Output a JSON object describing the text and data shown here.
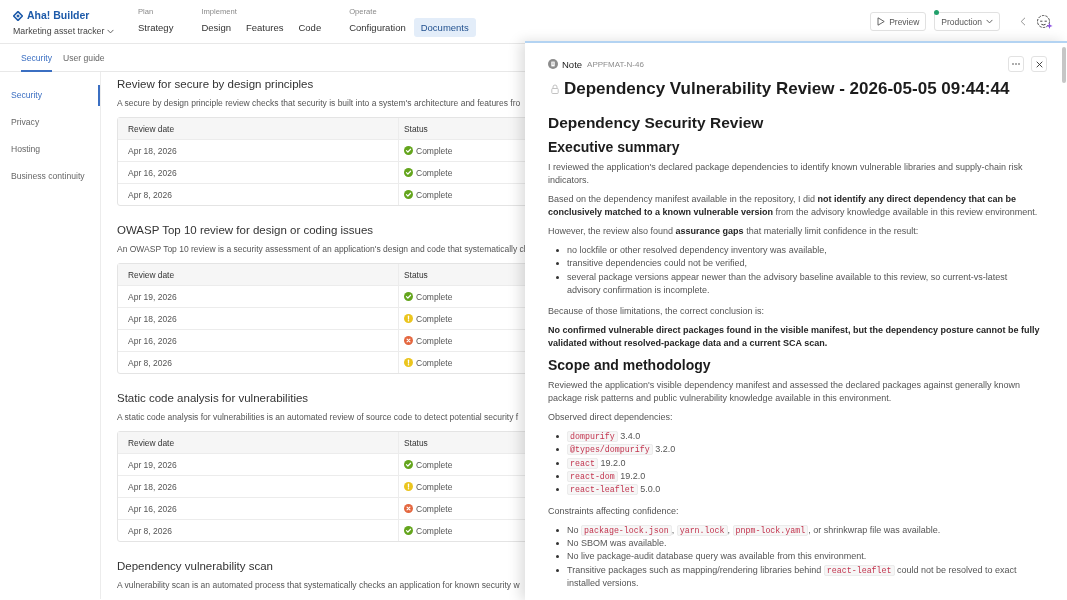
{
  "brand": {
    "name": "Aha! Builder",
    "workspace": "Marketing asset tracker"
  },
  "nav": [
    {
      "group": "Plan",
      "items": [
        {
          "label": "Strategy",
          "selected": false
        }
      ]
    },
    {
      "group": "Implement",
      "items": [
        {
          "label": "Design",
          "selected": false
        },
        {
          "label": "Features",
          "selected": false
        },
        {
          "label": "Code",
          "selected": false
        }
      ]
    },
    {
      "group": "Operate",
      "items": [
        {
          "label": "Configuration",
          "selected": false
        },
        {
          "label": "Documents",
          "selected": true
        }
      ]
    }
  ],
  "toolbar": {
    "preview": "Preview",
    "environment": "Production"
  },
  "tabs": [
    {
      "label": "Security",
      "selected": true
    },
    {
      "label": "User guide",
      "selected": false
    }
  ],
  "sidebar": {
    "items": [
      {
        "label": "Security",
        "selected": true
      },
      {
        "label": "Privacy",
        "selected": false
      },
      {
        "label": "Hosting",
        "selected": false
      },
      {
        "label": "Business continuity",
        "selected": false
      }
    ]
  },
  "sections": [
    {
      "title": "Review for secure by design principles",
      "description": "A secure by design principle review checks that security is built into a system's architecture and features fro",
      "table": {
        "columns": [
          "Review date",
          "Status"
        ],
        "rows": [
          {
            "date": "Apr 18, 2026",
            "status": "Complete",
            "kind": "passed"
          },
          {
            "date": "Apr 16, 2026",
            "status": "Complete",
            "kind": "passed"
          },
          {
            "date": "Apr 8, 2026",
            "status": "Complete",
            "kind": "passed"
          }
        ]
      }
    },
    {
      "title": "OWASP Top 10 review for design or coding issues",
      "description": "An OWASP Top 10 review is a security assessment of an application's design and code that systematically cl",
      "table": {
        "columns": [
          "Review date",
          "Status"
        ],
        "rows": [
          {
            "date": "Apr 19, 2026",
            "status": "Complete",
            "kind": "passed"
          },
          {
            "date": "Apr 18, 2026",
            "status": "Complete",
            "kind": "warning"
          },
          {
            "date": "Apr 16, 2026",
            "status": "Complete",
            "kind": "failed"
          },
          {
            "date": "Apr 8, 2026",
            "status": "Complete",
            "kind": "warning"
          }
        ]
      }
    },
    {
      "title": "Static code analysis for vulnerabilities",
      "description": "A static code analysis for vulnerabilities is an automated review of source code to detect potential security f",
      "table": {
        "columns": [
          "Review date",
          "Status"
        ],
        "rows": [
          {
            "date": "Apr 19, 2026",
            "status": "Complete",
            "kind": "passed"
          },
          {
            "date": "Apr 18, 2026",
            "status": "Complete",
            "kind": "warning"
          },
          {
            "date": "Apr 16, 2026",
            "status": "Complete",
            "kind": "failed"
          },
          {
            "date": "Apr 8, 2026",
            "status": "Complete",
            "kind": "passed"
          }
        ]
      }
    },
    {
      "title": "Dependency vulnerability scan",
      "description": "A vulnerability scan is an automated process that systematically checks an application for known security w"
    }
  ],
  "note": {
    "type": "Note",
    "id": "APPFMAT-N-46",
    "title": "Dependency Vulnerability Review - 2026-05-05 09:44:44",
    "blocks": [
      {
        "kind": "h1",
        "text": "Dependency Security Review"
      },
      {
        "kind": "h2",
        "text": "Executive summary"
      },
      {
        "kind": "p",
        "text": "I reviewed the application's declared package dependencies to identify known vulnerable libraries and supply-chain risk indicators."
      },
      {
        "kind": "p",
        "text": "Based on the dependency manifest available in the repository, I did **not identify any direct dependency that can be conclusively matched to a known vulnerable version** from the advisory knowledge available in this review environment."
      },
      {
        "kind": "p",
        "text": "However, the review also found **assurance gaps** that materially limit confidence in the result:"
      },
      {
        "kind": "ul",
        "items": [
          {
            "parts": [
              {
                "kind": "text",
                "text": "no lockfile or other resolved dependency inventory was available,"
              }
            ]
          },
          {
            "parts": [
              {
                "kind": "text",
                "text": "transitive dependencies could not be verified,"
              }
            ]
          },
          {
            "parts": [
              {
                "kind": "text",
                "text": "several package versions appear newer than the advisory baseline available to this review, so current-vs-latest advisory confirmation is incomplete."
              }
            ]
          }
        ]
      },
      {
        "kind": "p",
        "text": "Because of those limitations, the correct conclusion is:"
      },
      {
        "kind": "strong",
        "text": "No confirmed vulnerable direct packages found in the visible manifest, but the dependency posture cannot be fully validated without resolved-package data and a current SCA scan."
      },
      {
        "kind": "h2",
        "text": "Scope and methodology"
      },
      {
        "kind": "p",
        "text": "Reviewed the application's visible dependency manifest and assessed the declared packages against generally known package risk patterns and public vulnerability knowledge available in this environment."
      },
      {
        "kind": "p",
        "text": "Observed direct dependencies:"
      },
      {
        "kind": "ul",
        "items": [
          {
            "parts": [
              {
                "kind": "code",
                "text": "dompurify"
              },
              {
                "kind": "text",
                "text": " 3.4.0"
              }
            ]
          },
          {
            "parts": [
              {
                "kind": "code",
                "text": "@types/dompurify"
              },
              {
                "kind": "text",
                "text": " 3.2.0"
              }
            ]
          },
          {
            "parts": [
              {
                "kind": "code",
                "text": "react"
              },
              {
                "kind": "text",
                "text": " 19.2.0"
              }
            ]
          },
          {
            "parts": [
              {
                "kind": "code",
                "text": "react-dom"
              },
              {
                "kind": "text",
                "text": " 19.2.0"
              }
            ]
          },
          {
            "parts": [
              {
                "kind": "code",
                "text": "react-leaflet"
              },
              {
                "kind": "text",
                "text": " 5.0.0"
              }
            ]
          }
        ]
      },
      {
        "kind": "p",
        "text": "Constraints affecting confidence:"
      },
      {
        "kind": "ul",
        "items": [
          {
            "parts": [
              {
                "kind": "text",
                "text": "No "
              },
              {
                "kind": "code",
                "text": "package-lock.json"
              },
              {
                "kind": "text",
                "text": ", "
              },
              {
                "kind": "code",
                "text": "yarn.lock"
              },
              {
                "kind": "text",
                "text": ", "
              },
              {
                "kind": "code",
                "text": "pnpm-lock.yaml"
              },
              {
                "kind": "text",
                "text": ", or shrinkwrap file was available."
              }
            ]
          },
          {
            "parts": [
              {
                "kind": "text",
                "text": "No SBOM was available."
              }
            ]
          },
          {
            "parts": [
              {
                "kind": "text",
                "text": "No live package-audit database query was available from this environment."
              }
            ]
          },
          {
            "parts": [
              {
                "kind": "text",
                "text": "Transitive packages such as mapping/rendering libraries behind "
              },
              {
                "kind": "code",
                "text": "react-leaflet"
              },
              {
                "kind": "text",
                "text": " could not be resolved to exact installed versions."
              }
            ]
          }
        ]
      }
    ]
  }
}
